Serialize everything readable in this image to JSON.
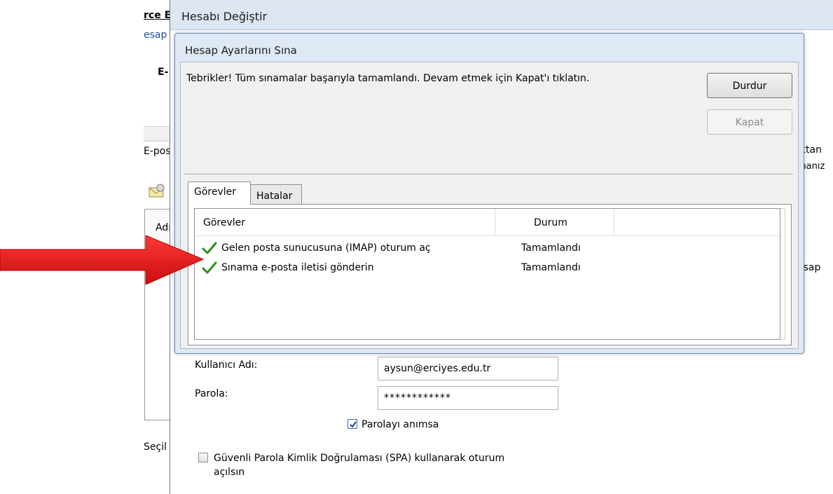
{
  "background_window": {
    "title_fragment": "rce E",
    "subtitle_fragment": "esap",
    "bold_fragment": "E-",
    "label_fragment": "E-pos",
    "list_header_fragment": "Adı",
    "footer_fragment": "Seçil"
  },
  "change_account": {
    "title": "Hesabı Değiştir",
    "right_fragment_1": "ıktan",
    "right_fragment_2": "manız",
    "right_fragment_3": "esap"
  },
  "test_dialog": {
    "title": "Hesap Ayarlarını Sına",
    "message": "Tebrikler! Tüm sınamalar başarıyla tamamlandı. Devam etmek için Kapat'ı tıklatın.",
    "stop_label": "Durdur",
    "close_label": "Kapat",
    "tabs": [
      {
        "label": "Görevler"
      },
      {
        "label": "Hatalar"
      }
    ],
    "columns": {
      "task": "Görevler",
      "status": "Durum"
    },
    "rows": [
      {
        "task": "Gelen posta sunucusuna (IMAP) oturum aç",
        "status": "Tamamlandı"
      },
      {
        "task": "Sınama e-posta iletisi gönderin",
        "status": "Tamamlandı"
      }
    ]
  },
  "form": {
    "username_label": "Kullanıcı Adı:",
    "username_value": "aysun@erciyes.edu.tr",
    "password_label": "Parola:",
    "password_value": "************",
    "remember_label": "Parolayı anımsa",
    "remember_checked": true,
    "spa_label_line1": "Güvenli Parola Kimlik Doğrulaması (SPA) kullanarak oturum",
    "spa_label_line2": "açılsın",
    "spa_checked": false
  },
  "colors": {
    "arrow": "#e8181c",
    "check": "#2e8b1e",
    "dialog_bg": "#dfe9f5"
  }
}
